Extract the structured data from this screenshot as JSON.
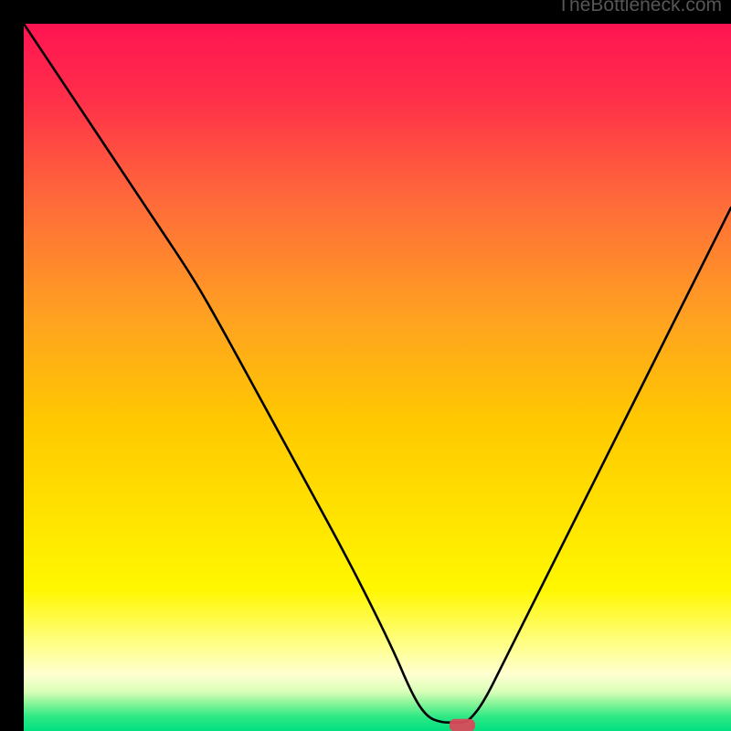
{
  "watermark": "TheBottleneck.com",
  "chart_data": {
    "type": "line",
    "title": "",
    "xlabel": "",
    "ylabel": "",
    "xlim": [
      0,
      100
    ],
    "ylim": [
      0,
      100
    ],
    "background_gradient": {
      "top_color": "#ff1452",
      "middle_color": "#ffd400",
      "bottom_yellowwhite": "#ffffbe",
      "bottom_green": "#00e080"
    },
    "curve_x": [
      0,
      6,
      12,
      18,
      24,
      28,
      34,
      40,
      46,
      52,
      55,
      57,
      59,
      61,
      62,
      63,
      65,
      68,
      72,
      78,
      84,
      90,
      96,
      100
    ],
    "curve_y": [
      100,
      91,
      82,
      73,
      64,
      57,
      46,
      35,
      24,
      12,
      5,
      2,
      1.2,
      1.2,
      1.2,
      1.5,
      4,
      10,
      18,
      30,
      42,
      54,
      66,
      74
    ],
    "marker": {
      "x": 62,
      "y": 0.8,
      "color": "#d94a5a"
    }
  }
}
